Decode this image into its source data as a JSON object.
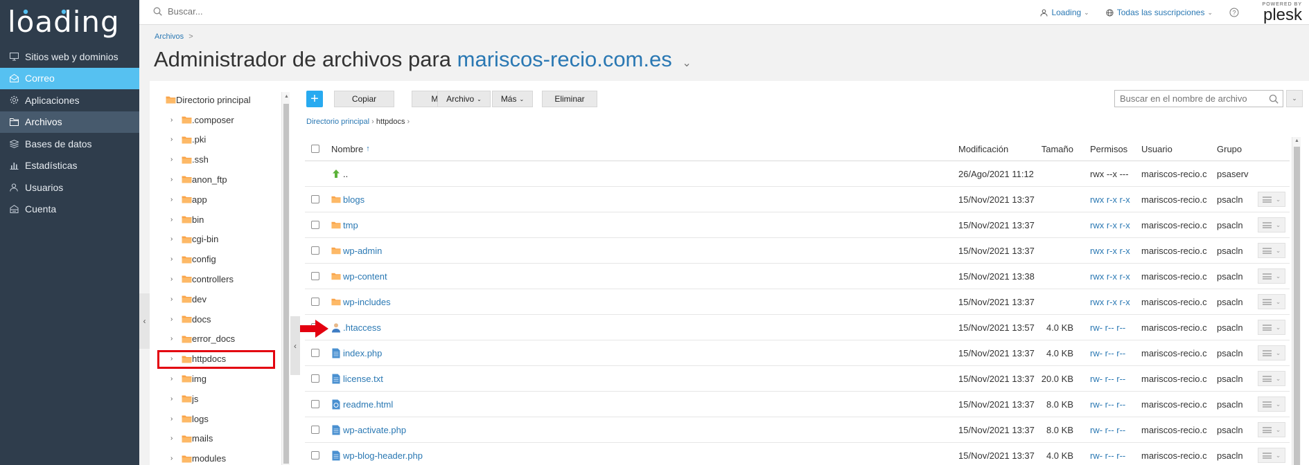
{
  "brand": {
    "logo_text": "loading",
    "accent": "#56c1f1",
    "sidebar_bg": "#2f3d4c"
  },
  "sidebar": {
    "items": [
      {
        "label": "Sitios web y dominios",
        "icon": "monitor-icon"
      },
      {
        "label": "Correo",
        "icon": "mail-icon",
        "state": "hover"
      },
      {
        "label": "Aplicaciones",
        "icon": "gear-icon"
      },
      {
        "label": "Archivos",
        "icon": "folder-icon",
        "state": "active"
      },
      {
        "label": "Bases de datos",
        "icon": "database-icon"
      },
      {
        "label": "Estadísticas",
        "icon": "chart-icon"
      },
      {
        "label": "Usuarios",
        "icon": "user-icon"
      },
      {
        "label": "Cuenta",
        "icon": "account-icon"
      }
    ]
  },
  "topbar": {
    "search_placeholder": "Buscar...",
    "user_menu": "Loading",
    "subscriptions_menu": "Todas las suscripciones",
    "help_icon": "question-icon",
    "plesk_powered": "POWERED BY",
    "plesk_logo": "plesk"
  },
  "header": {
    "breadcrumb": "Archivos",
    "breadcrumb_sep": ">",
    "title_prefix": "Administrador de archivos para",
    "title_domain": "mariscos-recio.com.es"
  },
  "tree": {
    "root": "Directorio principal",
    "items": [
      ".composer",
      ".pki",
      ".ssh",
      "anon_ftp",
      "app",
      "bin",
      "cgi-bin",
      "config",
      "controllers",
      "dev",
      "docs",
      "error_docs",
      "httpdocs",
      "img",
      "js",
      "logs",
      "mails",
      "modules"
    ],
    "highlighted": "httpdocs"
  },
  "toolbar": {
    "add_label": "+",
    "copy": "Copiar",
    "move": "Mover",
    "file": "Archivo",
    "more": "Más",
    "delete": "Eliminar",
    "search_placeholder": "Buscar en el nombre de archivo"
  },
  "path": {
    "root": "Directorio principal",
    "current": "httpdocs"
  },
  "table": {
    "columns": {
      "name": "Nombre",
      "sort_indicator": "↑",
      "modified": "Modificación",
      "size": "Tamaño",
      "perms": "Permisos",
      "user": "Usuario",
      "group": "Grupo"
    },
    "rows": [
      {
        "name": "..",
        "type": "up",
        "modified": "26/Ago/2021 11:12",
        "size": "",
        "perms": "rwx --x ---",
        "user": "mariscos-recio.c",
        "group": "psaserv"
      },
      {
        "name": "blogs",
        "type": "folder",
        "modified": "15/Nov/2021 13:37",
        "size": "",
        "perms": "rwx r-x r-x",
        "user": "mariscos-recio.c",
        "group": "psacln"
      },
      {
        "name": "tmp",
        "type": "folder",
        "modified": "15/Nov/2021 13:37",
        "size": "",
        "perms": "rwx r-x r-x",
        "user": "mariscos-recio.c",
        "group": "psacln"
      },
      {
        "name": "wp-admin",
        "type": "folder",
        "modified": "15/Nov/2021 13:37",
        "size": "",
        "perms": "rwx r-x r-x",
        "user": "mariscos-recio.c",
        "group": "psacln"
      },
      {
        "name": "wp-content",
        "type": "folder",
        "modified": "15/Nov/2021 13:38",
        "size": "",
        "perms": "rwx r-x r-x",
        "user": "mariscos-recio.c",
        "group": "psacln"
      },
      {
        "name": "wp-includes",
        "type": "folder",
        "modified": "15/Nov/2021 13:37",
        "size": "",
        "perms": "rwx r-x r-x",
        "user": "mariscos-recio.c",
        "group": "psacln"
      },
      {
        "name": ".htaccess",
        "type": "user",
        "modified": "15/Nov/2021 13:57",
        "size": "4.0 KB",
        "perms": "rw- r-- r--",
        "user": "mariscos-recio.c",
        "group": "psacln"
      },
      {
        "name": "index.php",
        "type": "file",
        "modified": "15/Nov/2021 13:37",
        "size": "4.0 KB",
        "perms": "rw- r-- r--",
        "user": "mariscos-recio.c",
        "group": "psacln"
      },
      {
        "name": "license.txt",
        "type": "file",
        "modified": "15/Nov/2021 13:37",
        "size": "20.0 KB",
        "perms": "rw- r-- r--",
        "user": "mariscos-recio.c",
        "group": "psacln"
      },
      {
        "name": "readme.html",
        "type": "html",
        "modified": "15/Nov/2021 13:37",
        "size": "8.0 KB",
        "perms": "rw- r-- r--",
        "user": "mariscos-recio.c",
        "group": "psacln"
      },
      {
        "name": "wp-activate.php",
        "type": "file",
        "modified": "15/Nov/2021 13:37",
        "size": "8.0 KB",
        "perms": "rw- r-- r--",
        "user": "mariscos-recio.c",
        "group": "psacln"
      },
      {
        "name": "wp-blog-header.php",
        "type": "file",
        "modified": "15/Nov/2021 13:37",
        "size": "4.0 KB",
        "perms": "rw- r-- r--",
        "user": "mariscos-recio.c",
        "group": "psacln"
      }
    ]
  }
}
